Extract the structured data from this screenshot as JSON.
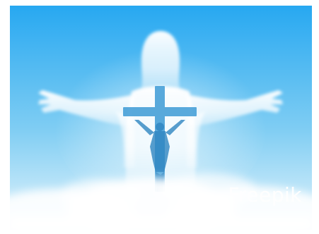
{
  "image": {
    "watermark_text": "Freepik",
    "colors": {
      "sky_top": "#2aa9f2",
      "sky_bottom": "#d8f0fb",
      "figure": "#ffffff",
      "cross": "#3d9bd6",
      "cloud": "#ffffff"
    }
  }
}
